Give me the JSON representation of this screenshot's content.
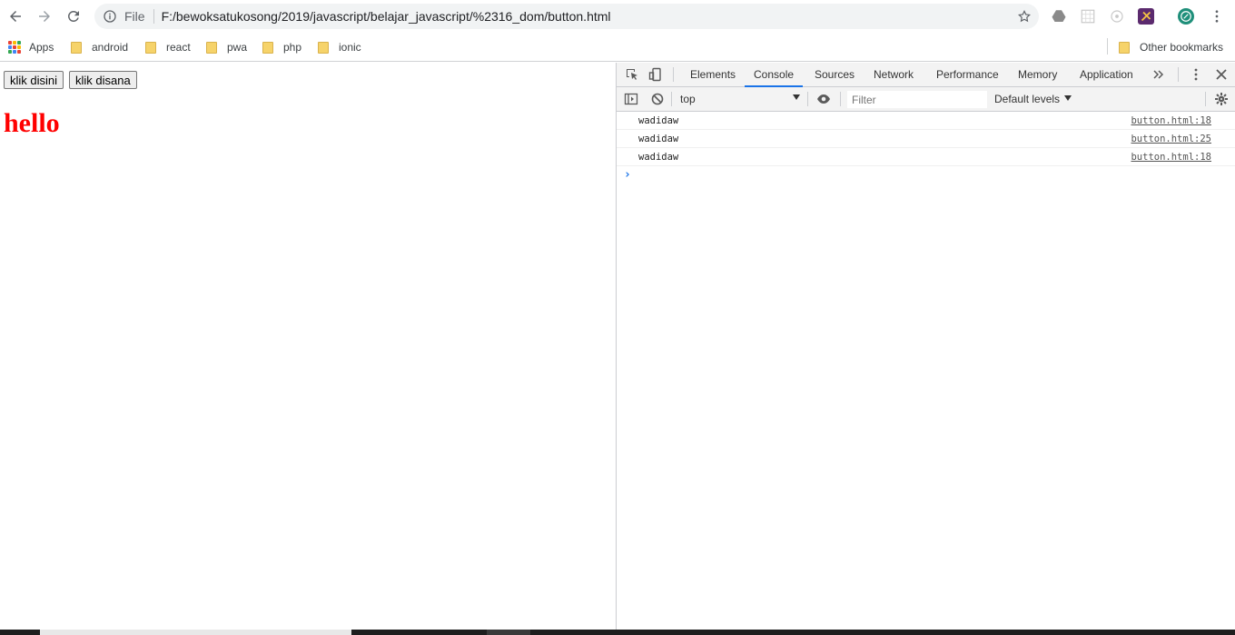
{
  "browser": {
    "url_scheme": "File",
    "url": "F:/bewoksatukosong/2019/javascript/belajar_javascript/%2316_dom/button.html"
  },
  "bookmarks": {
    "apps": "Apps",
    "folders": [
      "android",
      "react",
      "pwa",
      "php",
      "ionic"
    ],
    "other": "Other bookmarks"
  },
  "page": {
    "buttons": [
      "klik disini",
      "klik disana"
    ],
    "heading": "hello",
    "heading_color": "#ff0000"
  },
  "devtools": {
    "tabs": [
      "Elements",
      "Console",
      "Sources",
      "Network",
      "Performance",
      "Memory",
      "Application"
    ],
    "active_tab": "Console",
    "context": "top",
    "filter_placeholder": "Filter",
    "levels": "Default levels",
    "messages": [
      {
        "text": "wadidaw",
        "source": "button.html:18"
      },
      {
        "text": "wadidaw",
        "source": "button.html:25"
      },
      {
        "text": "wadidaw",
        "source": "button.html:18"
      }
    ],
    "prompt_symbol": "›",
    "accent_color": "#1a73e8"
  },
  "icons": {
    "toolbar": [
      "back-arrow-icon",
      "forward-arrow-icon",
      "reload-icon",
      "info-icon",
      "star-icon",
      "menu-dots-icon"
    ],
    "devtools": [
      "inspect-element-icon",
      "device-toolbar-icon",
      "sidebar-toggle-icon",
      "clear-console-icon",
      "eye-icon",
      "settings-gear-icon",
      "more-tabs-icon",
      "close-icon"
    ]
  }
}
